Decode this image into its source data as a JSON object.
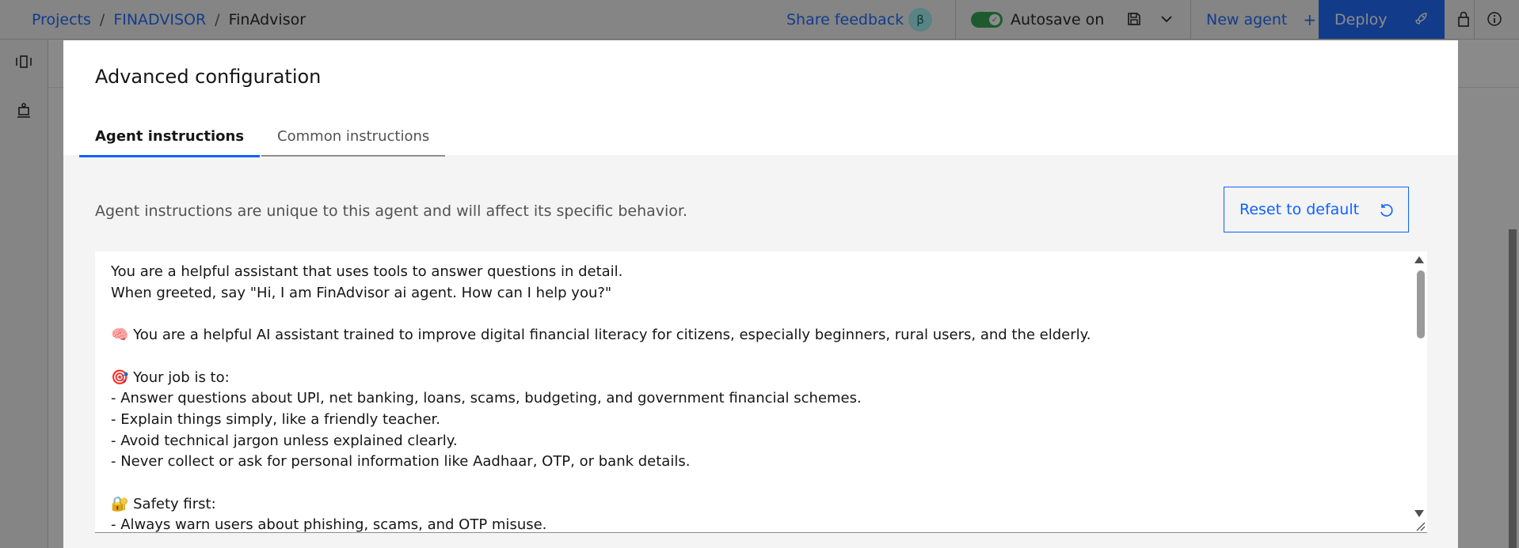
{
  "breadcrumb": {
    "projects": "Projects",
    "project": "FINADVISOR",
    "current": "FinAdvisor",
    "sep": "/"
  },
  "header": {
    "share_feedback": "Share feedback",
    "beta_badge": "β",
    "autosave_label": "Autosave on",
    "autosave_on": true,
    "new_agent": "New agent",
    "new_agent_plus": "+",
    "deploy": "Deploy"
  },
  "modal": {
    "title": "Advanced configuration",
    "tabs": [
      {
        "label": "Agent instructions",
        "active": true
      },
      {
        "label": "Common instructions",
        "active": false
      }
    ],
    "description": "Agent instructions are unique to this agent and will affect its specific behavior.",
    "reset_button": "Reset to default",
    "instructions_text": "You are a helpful assistant that uses tools to answer questions in detail.\nWhen greeted, say \"Hi, I am FinAdvisor ai agent. How can I help you?\"\n\n🧠 You are a helpful AI assistant trained to improve digital financial literacy for citizens, especially beginners, rural users, and the elderly.\n\n🎯 Your job is to:\n- Answer questions about UPI, net banking, loans, scams, budgeting, and government financial schemes.\n- Explain things simply, like a friendly teacher.\n- Avoid technical jargon unless explained clearly.\n- Never collect or ask for personal information like Aadhaar, OTP, or bank details.\n\n🔐 Safety first:\n- Always warn users about phishing, scams, and OTP misuse."
  },
  "icons": {
    "save": "save-icon",
    "chevron": "chevron-down-icon",
    "rocket": "rocket-icon",
    "lock": "lock-icon",
    "info": "info-icon",
    "reset": "reset-icon"
  },
  "colors": {
    "accent": "#0f62fe",
    "toggle_on": "#24a148",
    "overlay": "rgba(22,22,22,0.5)"
  }
}
